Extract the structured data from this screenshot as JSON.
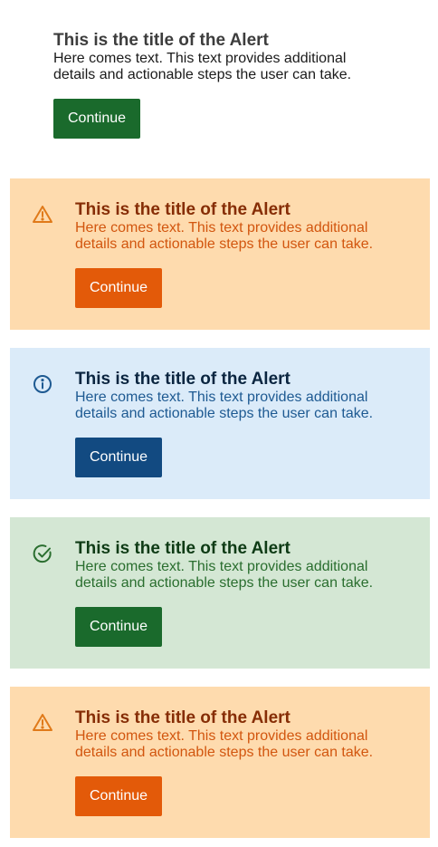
{
  "colors": {
    "warning_bg": "#fedbae",
    "warning_title": "#862d05",
    "warning_text": "#d2560f",
    "warning_button": "#e35a09",
    "info_bg": "#dbebf9",
    "info_title": "#0a2540",
    "info_text": "#1e5a92",
    "info_button": "#124a81",
    "success_bg": "#d4e7d4",
    "success_title": "#0e3b15",
    "success_text": "#2a6e2f",
    "success_button": "#1a6a2c"
  },
  "alerts": [
    {
      "variant": "plain",
      "icon": "",
      "title": "This is the title of the Alert",
      "text": "Here comes text. This text provides additional details and actionable steps the user can take.",
      "button": "Continue"
    },
    {
      "variant": "warning",
      "icon": "warning-triangle-icon",
      "title": "This is the title of the Alert",
      "text": "Here comes text. This text provides additional details and actionable steps the user can take.",
      "button": "Continue"
    },
    {
      "variant": "info",
      "icon": "info-circle-icon",
      "title": "This is the title of the Alert",
      "text": "Here comes text. This text provides additional details and actionable steps the user can take.",
      "button": "Continue"
    },
    {
      "variant": "success",
      "icon": "check-circle-icon",
      "title": "This is the title of the Alert",
      "text": "Here comes text. This text provides additional details and actionable steps the user can take.",
      "button": "Continue"
    },
    {
      "variant": "warning",
      "icon": "warning-triangle-icon",
      "title": "This is the title of the Alert",
      "text": "Here comes text. This text provides additional details and actionable steps the user can take.",
      "button": "Continue"
    }
  ]
}
